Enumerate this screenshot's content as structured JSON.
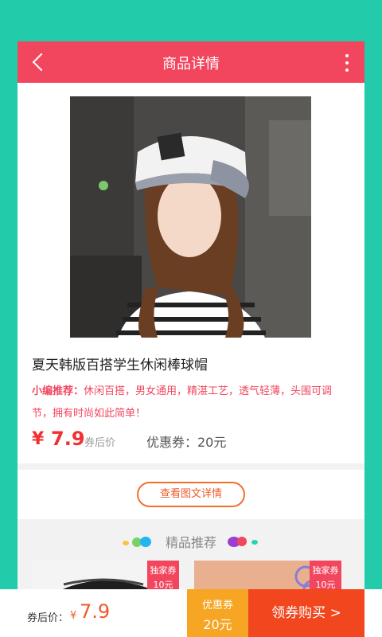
{
  "header": {
    "title": "商品详情"
  },
  "product": {
    "title": "夏天韩版百搭学生休闲棒球帽",
    "rec_label": "小编推荐：",
    "rec_text": "休闲百搭，男女通用，精湛工艺，透气轻薄，头围可调节，拥有时尚如此简单！",
    "currency": "¥",
    "price": "7.9",
    "price_note": "券后价",
    "coupon_text": "优惠券：20元"
  },
  "detail_button": "查看图文详情",
  "recommend": {
    "heading": "精品推荐",
    "cards": [
      {
        "tag_line1": "独家券",
        "tag_line2": "10元"
      },
      {
        "tag_line1": "独家券",
        "tag_line2": "10元"
      }
    ]
  },
  "bottom_bar": {
    "label": "券后价：",
    "currency": "¥",
    "price": "7.9",
    "coupon_line1": "优惠券",
    "coupon_line2": "20元",
    "buy_label": "领券购买 >"
  },
  "colors": {
    "background": "#22cbaa",
    "header": "#f2465e",
    "price": "#f23030",
    "coupon_button": "#f6a623",
    "buy_button": "#f2461e"
  }
}
